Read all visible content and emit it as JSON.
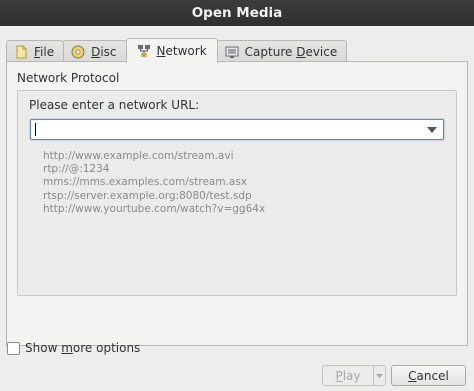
{
  "window": {
    "title": "Open Media"
  },
  "tabs": [
    {
      "pre": "",
      "mnemonic": "F",
      "post": "ile",
      "icon": "file-icon"
    },
    {
      "pre": "",
      "mnemonic": "D",
      "post": "isc",
      "icon": "disc-icon"
    },
    {
      "pre": "",
      "mnemonic": "N",
      "post": "etwork",
      "icon": "network-icon",
      "active": true
    },
    {
      "pre": "Capture ",
      "mnemonic": "D",
      "post": "evice",
      "icon": "capture-device-icon"
    }
  ],
  "network": {
    "group_title": "Network Protocol",
    "url_label": "Please enter a network URL:",
    "url_value": "",
    "examples": [
      "http://www.example.com/stream.avi",
      "rtp://@:1234",
      "mms://mms.examples.com/stream.asx",
      "rtsp://server.example.org:8080/test.sdp",
      "http://www.yourtube.com/watch?v=gg64x"
    ]
  },
  "options": {
    "pre": "Show ",
    "mnemonic": "m",
    "post": "ore options",
    "checked": false
  },
  "buttons": {
    "play": {
      "pre": "",
      "mnemonic": "P",
      "post": "lay",
      "enabled": false
    },
    "cancel": {
      "pre": "",
      "mnemonic": "C",
      "post": "ancel"
    }
  }
}
